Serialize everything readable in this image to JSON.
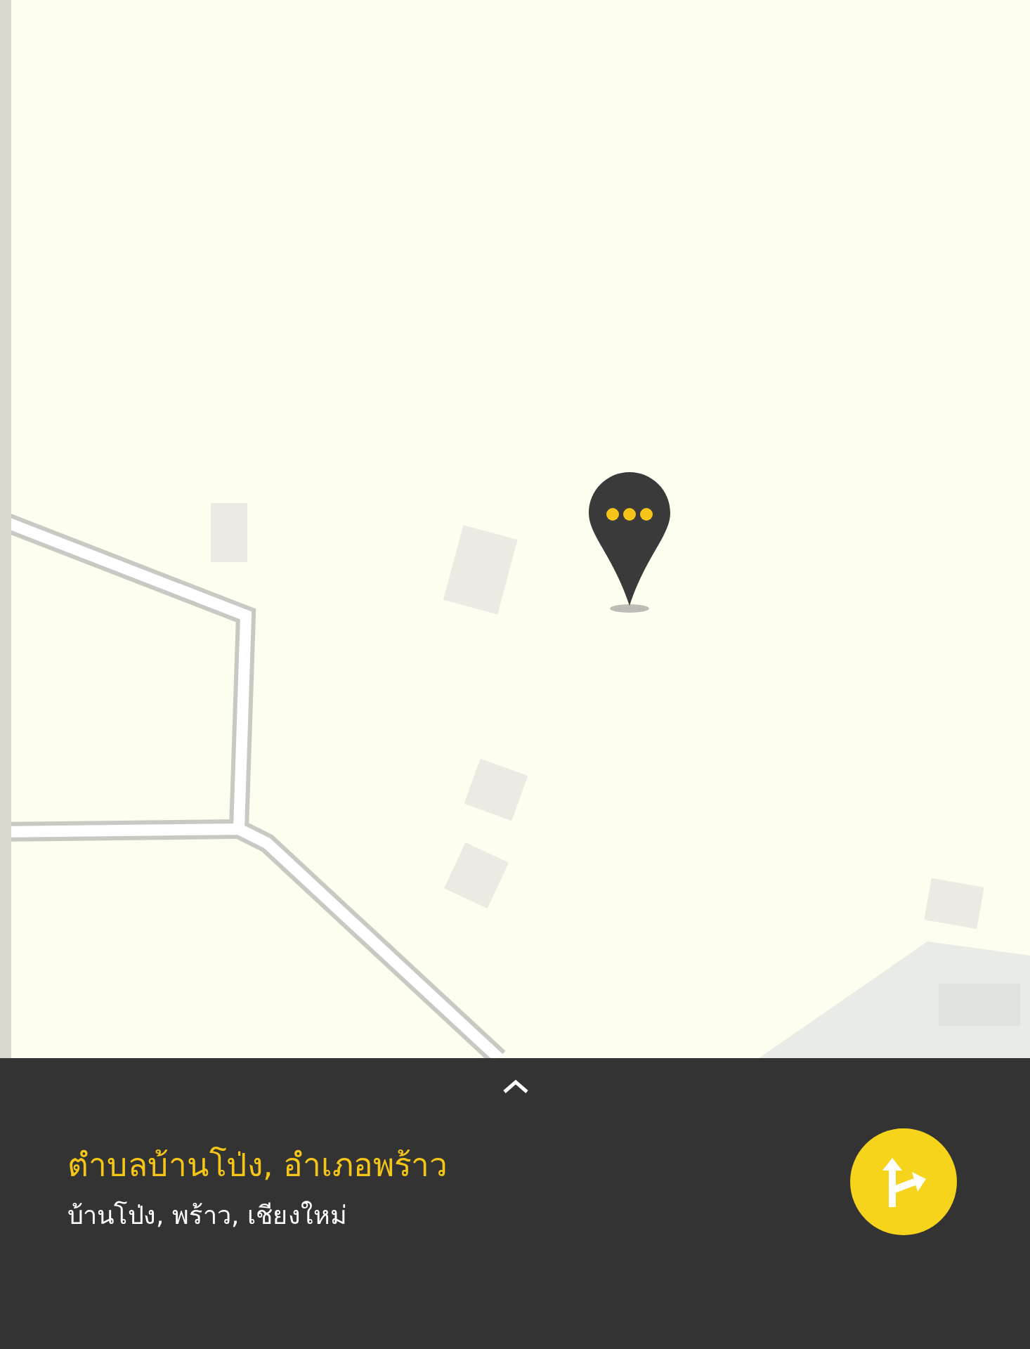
{
  "place": {
    "title": "ตำบลบ้านโป่ง, อำเภอพร้าว",
    "subtitle": "บ้านโป่ง, พร้าว, เชียงใหม่"
  }
}
